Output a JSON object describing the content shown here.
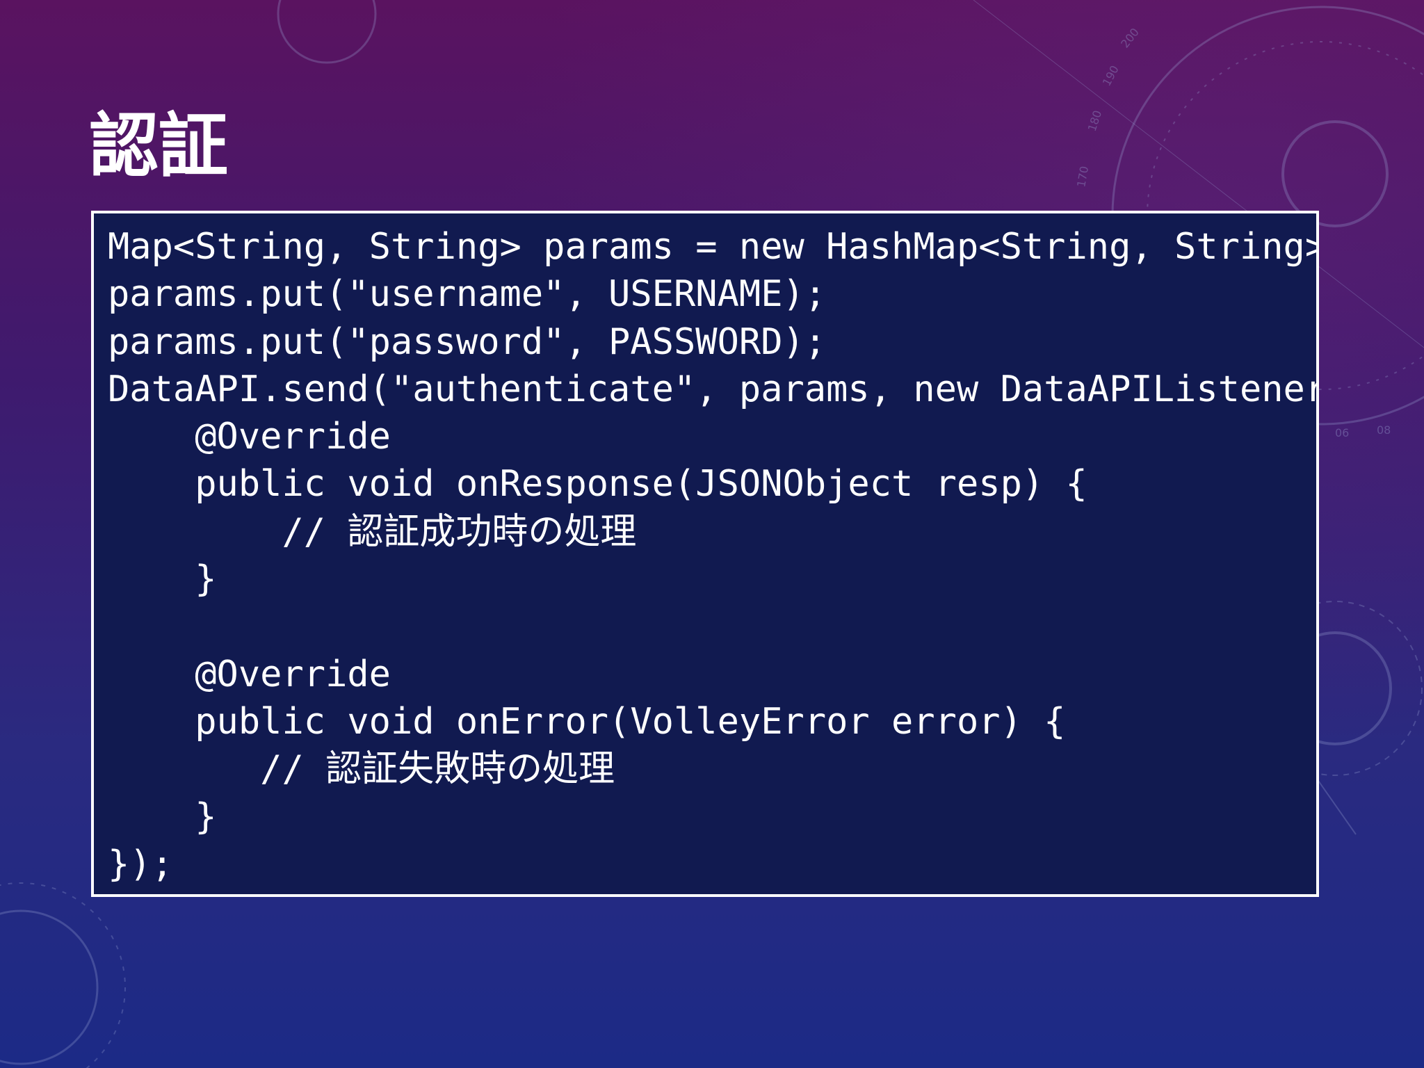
{
  "slide": {
    "title": "認証"
  },
  "code": {
    "lines": [
      "Map<String, String> params = new HashMap<String, String>();",
      "params.put(\"username\", USERNAME);",
      "params.put(\"password\", PASSWORD);",
      "DataAPI.send(\"authenticate\", params, new DataAPIListener() {",
      "    @Override",
      "    public void onResponse(JSONObject resp) {",
      "        // 認証成功時の処理",
      "    }",
      "",
      "    @Override",
      "    public void onError(VolleyError error) {",
      "       // 認証失敗時の処理",
      "    }",
      "});"
    ]
  },
  "background": {
    "dial_numbers": [
      "170",
      "180",
      "190",
      "200",
      "06",
      "08"
    ]
  },
  "colors": {
    "code_background": "#111a50",
    "code_border": "#ffffff",
    "text": "#ffffff"
  }
}
